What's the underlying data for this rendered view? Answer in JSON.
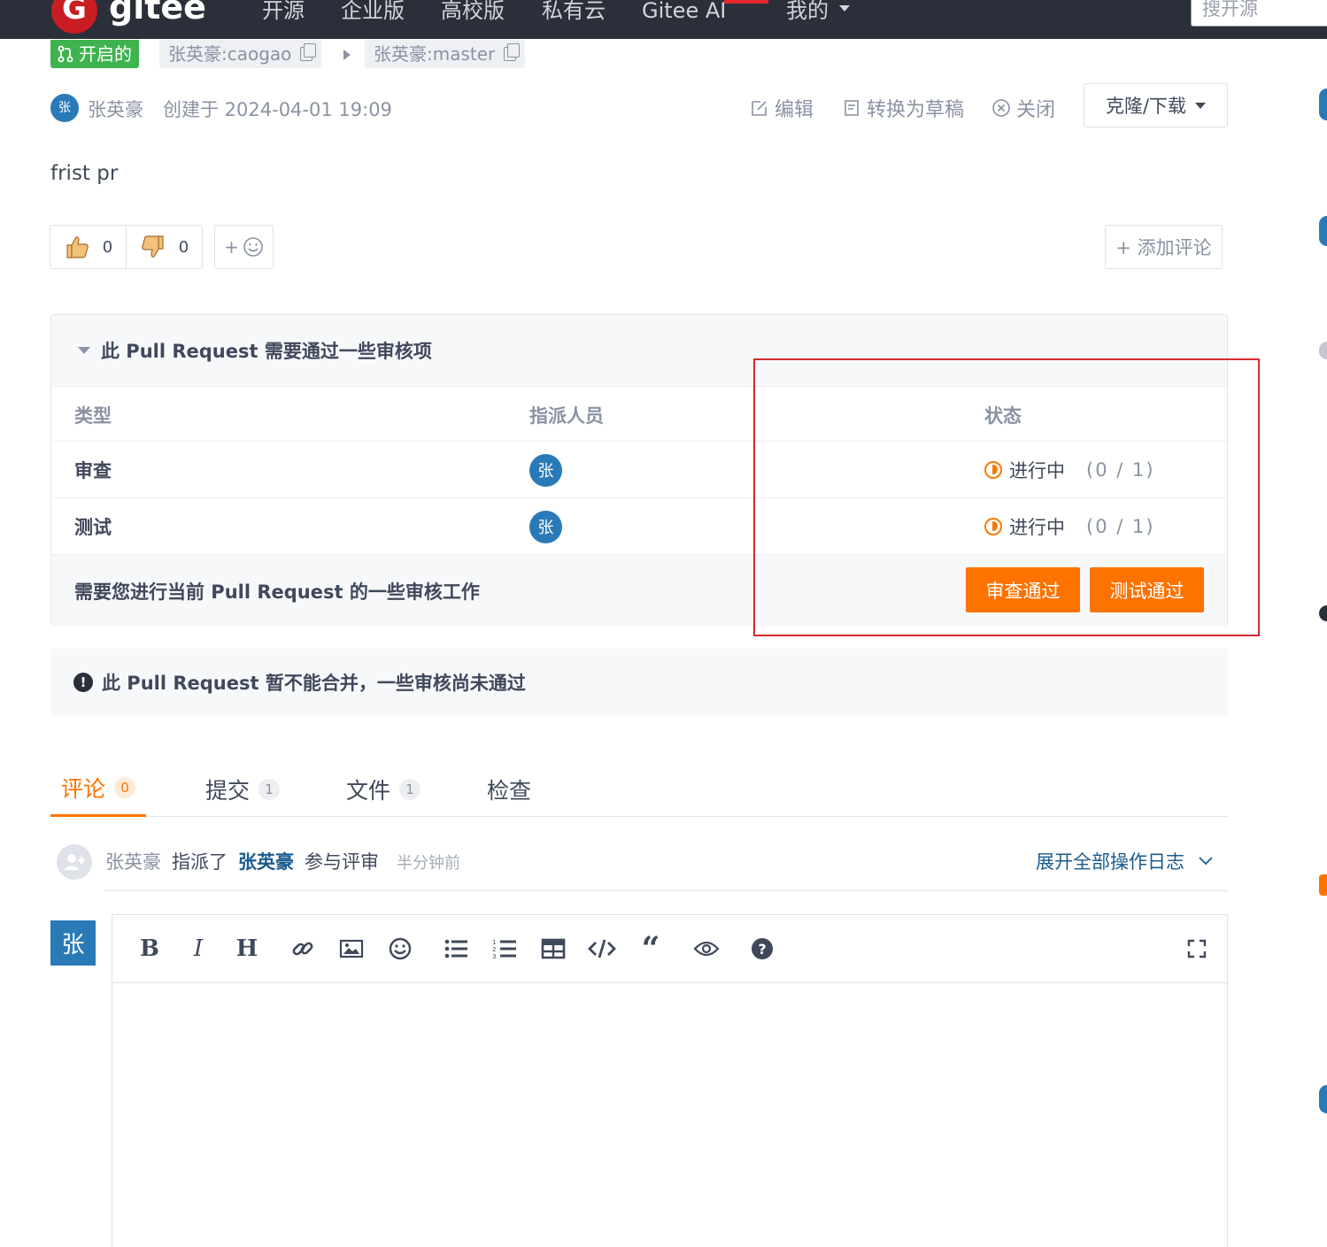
{
  "nav": {
    "logo_letter": "G",
    "logo_text": "gitee",
    "items": [
      "开源",
      "企业版",
      "高校版",
      "私有云",
      "Gitee AI",
      "我的"
    ],
    "search_placeholder": "搜开源"
  },
  "pr": {
    "state": "开启的",
    "source_branch": "张英豪:caogao",
    "target_branch": "张英豪:master",
    "author_avatar": "张",
    "author": "张英豪",
    "created": "创建于 2024-04-01 19:09",
    "actions": {
      "edit": "编辑",
      "draft": "转换为草稿",
      "close": "关闭",
      "clone": "克隆/下载"
    },
    "description": "frist pr",
    "reactions": {
      "thumbs_up": "0",
      "thumbs_down": "0",
      "add": "+"
    },
    "add_comment": "+ 添加评论"
  },
  "review": {
    "title": "此 Pull Request 需要通过一些审核项",
    "headers": {
      "type": "类型",
      "assignee": "指派人员",
      "status": "状态"
    },
    "rows": [
      {
        "type": "审查",
        "avatar": "张",
        "status": "进行中",
        "count": "(0 / 1)"
      },
      {
        "type": "测试",
        "avatar": "张",
        "status": "进行中",
        "count": "(0 / 1)"
      }
    ],
    "footer_text": "需要您进行当前 Pull Request 的一些审核工作",
    "approve_review": "审查通过",
    "approve_test": "测试通过"
  },
  "merge_warning": "此 Pull Request 暂不能合并，一些审核尚未通过",
  "tabs": [
    {
      "label": "评论",
      "count": "0"
    },
    {
      "label": "提交",
      "count": "1"
    },
    {
      "label": "文件",
      "count": "1"
    },
    {
      "label": "检查",
      "count": ""
    }
  ],
  "log": {
    "actor": "张英豪",
    "verb": "指派了",
    "target": "张英豪",
    "action": "参与评审",
    "time": "半分钟前",
    "expand": "展开全部操作日志"
  },
  "editor": {
    "avatar": "张",
    "toolbar": [
      "bold",
      "italic",
      "heading",
      "link",
      "image",
      "emoji",
      "bullet-list",
      "numbered-list",
      "table",
      "code",
      "quote",
      "preview",
      "help",
      "fullscreen"
    ]
  },
  "colors": {
    "accent": "#fe7300",
    "nav_bg": "#2b2f3a",
    "open_state": "#3fb34f",
    "avatar": "#2a7ab8",
    "highlight": "#d42a2e"
  }
}
